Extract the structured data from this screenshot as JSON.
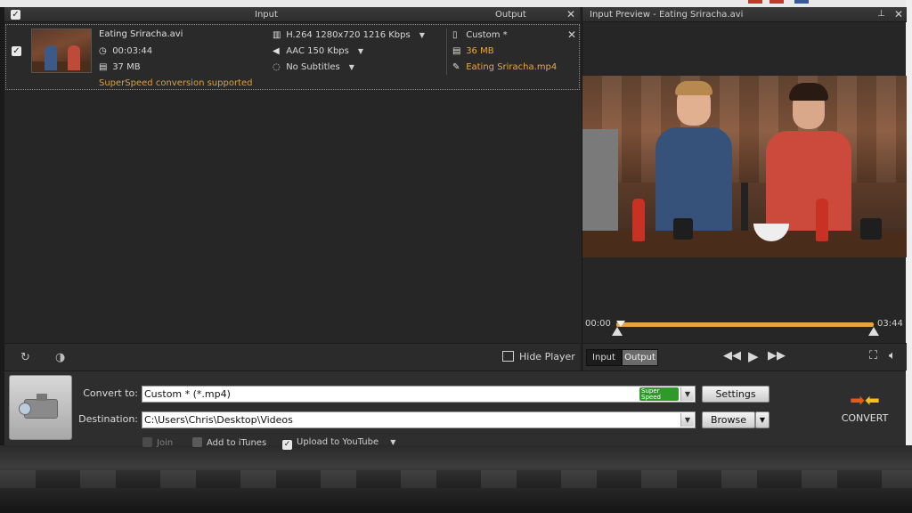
{
  "list": {
    "header": {
      "input_label": "Input",
      "output_label": "Output"
    },
    "item": {
      "input": {
        "filename": "Eating Sriracha.avi",
        "duration": "00:03:44",
        "size": "37 MB",
        "video": "H.264 1280x720 1216 Kbps",
        "audio": "AAC 150 Kbps",
        "subtitles": "No Subtitles",
        "note": "SuperSpeed conversion supported"
      },
      "output": {
        "profile": "Custom *",
        "size": "36 MB",
        "filename": "Eating Sriracha.mp4"
      }
    },
    "toolbar": {
      "hide_player_label": "Hide Player"
    }
  },
  "preview": {
    "title": "Input Preview - Eating Sriracha.avi",
    "time_start": "00:00",
    "time_end": "03:44",
    "progress_fraction": 1.0,
    "tabs": [
      {
        "label": "Input",
        "selected": false
      },
      {
        "label": "Output",
        "selected": true
      }
    ]
  },
  "convert": {
    "convert_to_label": "Convert to:",
    "convert_to_value": "Custom * (*.mp4)",
    "superspeed_badge_line1": "Super",
    "superspeed_badge_line2": "Speed",
    "settings_label": "Settings",
    "destination_label": "Destination:",
    "destination_value": "C:\\Users\\Chris\\Desktop\\Videos",
    "browse_label": "Browse",
    "options": {
      "join": "Join",
      "itunes": "Add to iTunes",
      "youtube": "Upload to YouTube"
    },
    "convert_button_label": "CONVERT"
  },
  "icons": {
    "clock": "clock-icon",
    "file": "file-icon",
    "film": "film-icon",
    "speaker": "speaker-icon",
    "subtitle": "speech-bubble-icon",
    "phone": "device-icon",
    "pencil": "pencil-icon"
  },
  "colors": {
    "accent_orange": "#e9a93a",
    "progress": "#e6a53a",
    "superspeed_green": "#2f9a2a"
  }
}
